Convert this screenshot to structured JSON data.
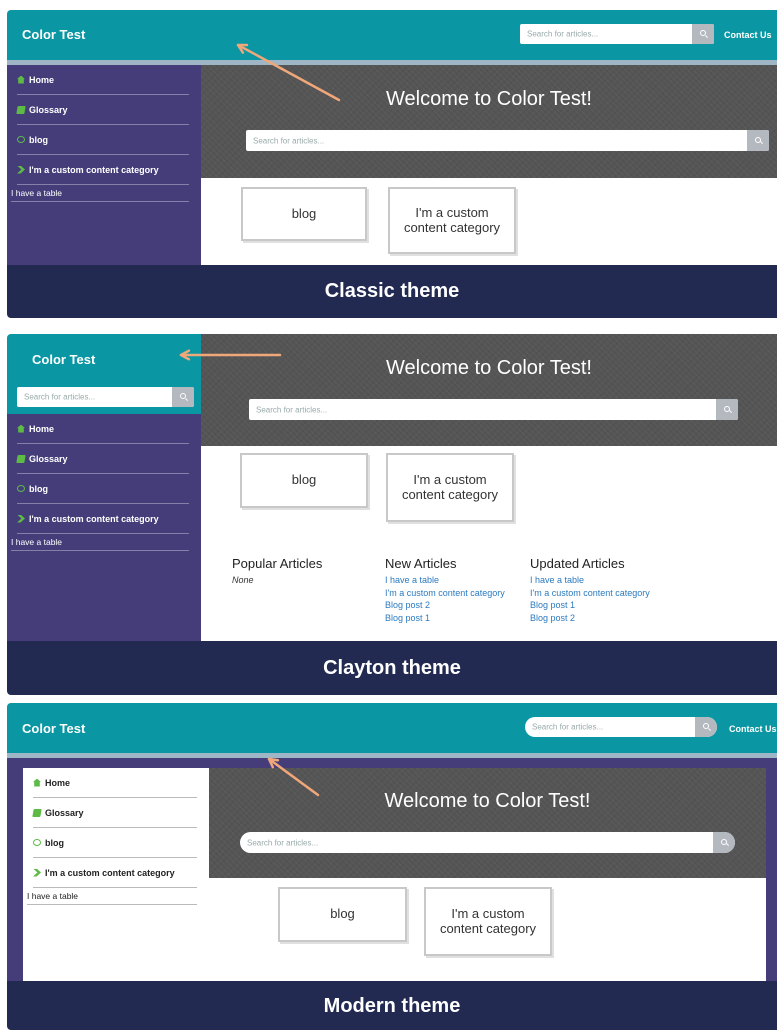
{
  "brand": "Color Test",
  "search": {
    "placeholder": "Search for articles..."
  },
  "contact": "Contact Us",
  "welcome": "Welcome to Color Test!",
  "nav": {
    "home": "Home",
    "glossary": "Glossary",
    "blog": "blog",
    "custom": "I'm a custom content category",
    "table": "I have a table"
  },
  "cards": {
    "blog": "blog",
    "custom": "I'm a custom content category"
  },
  "themes": {
    "classic": "Classic theme",
    "clayton": "Clayton theme",
    "modern": "Modern theme"
  },
  "articles": {
    "popular": {
      "title": "Popular Articles",
      "empty": "None"
    },
    "new": {
      "title": "New Articles",
      "items": [
        "I have a table",
        "I'm a custom content category",
        "Blog post 2",
        "Blog post 1"
      ]
    },
    "updated": {
      "title": "Updated Articles",
      "items": [
        "I have a table",
        "I'm a custom content category",
        "Blog post 1",
        "Blog post 2"
      ]
    }
  },
  "colors": {
    "header": "#0a96a2",
    "sidebar": "#453d7a",
    "banner": "#222a52",
    "hero": "#555555",
    "icon": "#5dbb45",
    "link": "#2b7abf",
    "arrow": "#f0a77a"
  }
}
